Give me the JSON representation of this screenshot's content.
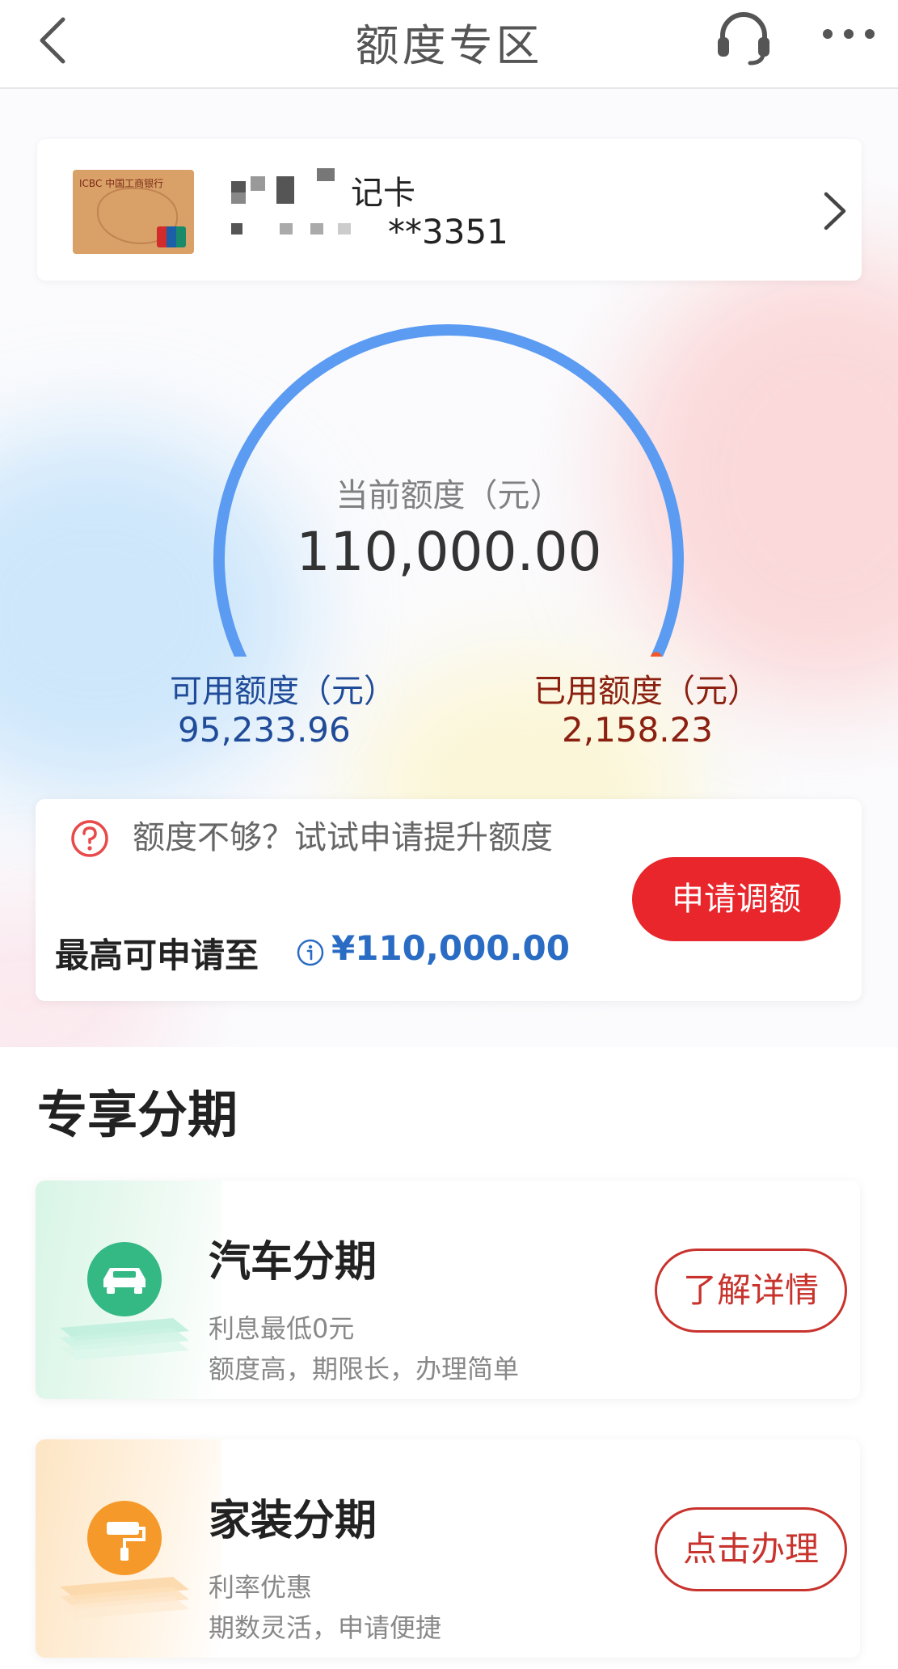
{
  "header": {
    "title": "额度专区",
    "back_icon": "chevron-left-icon",
    "service_icon": "headset-icon",
    "more_icon": "more-dots-icon"
  },
  "card": {
    "name": "记卡",
    "number": "**3351",
    "chevron_icon": "chevron-right-icon"
  },
  "limit": {
    "current_label": "当前额度（元）",
    "current_value": "110,000.00",
    "available_label": "可用额度（元）",
    "available_value": "95,233.96",
    "used_label": "已用额度（元）",
    "used_value": "2,158.23",
    "used_fraction": 0.0196
  },
  "apply": {
    "hint": "额度不够？试试申请提升额度",
    "max_label": "最高可申请至",
    "max_value": "¥110,000.00",
    "button": "申请调额"
  },
  "section": {
    "title": "专享分期"
  },
  "promos": [
    {
      "title": "汽车分期",
      "line1": "利息最低0元",
      "line2": "额度高，期限长，办理简单",
      "button": "了解详情",
      "icon": "car-icon"
    },
    {
      "title": "家装分期",
      "line1": "利率优惠",
      "line2": "期数灵活，申请便捷",
      "button": "点击办理",
      "icon": "paint-roller-icon"
    }
  ],
  "colors": {
    "gauge_blue": "#5b9bf2",
    "gauge_used": "#f2552c",
    "apply_red": "#e8262c",
    "available_text": "#1f4b99",
    "used_text": "#8b2010"
  }
}
